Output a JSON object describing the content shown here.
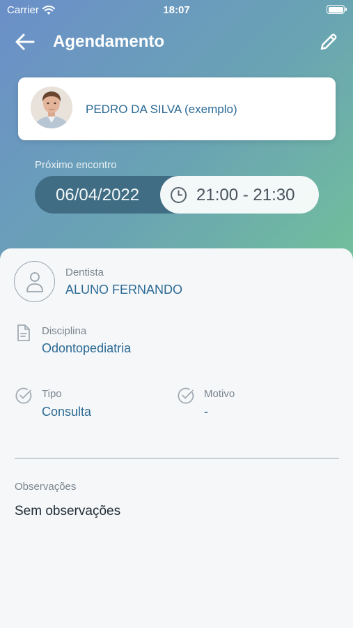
{
  "status_bar": {
    "carrier": "Carrier",
    "time": "18:07"
  },
  "nav": {
    "title": "Agendamento"
  },
  "patient": {
    "name": "PEDRO DA SILVA (exemplo)"
  },
  "appointment": {
    "next_label": "Próximo encontro",
    "date": "06/04/2022",
    "time_range": "21:00 - 21:30"
  },
  "details": {
    "dentist_label": "Dentista",
    "dentist_value": "ALUNO FERNANDO",
    "discipline_label": "Disciplina",
    "discipline_value": "Odontopediatria",
    "type_label": "Tipo",
    "type_value": "Consulta",
    "reason_label": "Motivo",
    "reason_value": "-"
  },
  "observations": {
    "label": "Observações",
    "value": "Sem observações"
  },
  "colors": {
    "accent": "#2c6a94",
    "date_pill": "#3d6980"
  },
  "icons": [
    "wifi-icon",
    "battery-icon",
    "back-arrow-icon",
    "pencil-icon",
    "clock-icon",
    "user-icon",
    "document-icon",
    "check-circle-icon"
  ]
}
